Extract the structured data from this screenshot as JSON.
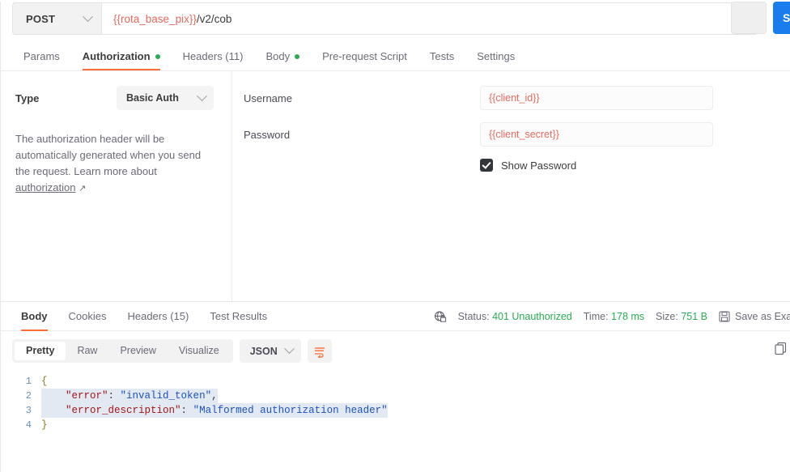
{
  "request": {
    "method": "POST",
    "url_variable": "{{rota_base_pix}}",
    "url_path": "/v2/cob",
    "send_label": "Send",
    "tabs": [
      {
        "label": "Params",
        "active": false,
        "dot": false
      },
      {
        "label": "Authorization",
        "active": true,
        "dot": true
      },
      {
        "label": "Headers (11)",
        "active": false,
        "dot": false
      },
      {
        "label": "Body",
        "active": false,
        "dot": true
      },
      {
        "label": "Pre-request Script",
        "active": false,
        "dot": false
      },
      {
        "label": "Tests",
        "active": false,
        "dot": false
      },
      {
        "label": "Settings",
        "active": false,
        "dot": false
      }
    ]
  },
  "authorization": {
    "type_label": "Type",
    "type_value": "Basic Auth",
    "help_text_part1": "The authorization header will be automatically generated when you send the request. Learn more about ",
    "help_link": "authorization",
    "help_link_arrow": "↗",
    "username_label": "Username",
    "username_value": "{{client_id}}",
    "password_label": "Password",
    "password_value": "{{client_secret}}",
    "show_password_label": "Show Password",
    "show_password_checked": true
  },
  "response": {
    "tabs": [
      {
        "label": "Body",
        "active": true
      },
      {
        "label": "Cookies",
        "active": false
      },
      {
        "label": "Headers (15)",
        "active": false
      },
      {
        "label": "Test Results",
        "active": false
      }
    ],
    "status_label": "Status:",
    "status_value": "401 Unauthorized",
    "time_label": "Time:",
    "time_value": "178 ms",
    "size_label": "Size:",
    "size_value": "751 B",
    "save_example_label": "Save as Exa",
    "format_pills": [
      {
        "label": "Pretty",
        "active": true
      },
      {
        "label": "Raw",
        "active": false
      },
      {
        "label": "Preview",
        "active": false
      },
      {
        "label": "Visualize",
        "active": false
      }
    ],
    "language": "JSON",
    "body_lines": [
      {
        "num": "1",
        "selected": false,
        "segments": [
          {
            "t": "{",
            "c": "brace"
          }
        ]
      },
      {
        "num": "2",
        "selected": true,
        "segments": [
          {
            "t": "    ",
            "c": "punc"
          },
          {
            "t": "\"error\"",
            "c": "key"
          },
          {
            "t": ": ",
            "c": "punc"
          },
          {
            "t": "\"invalid_token\"",
            "c": "str"
          },
          {
            "t": ",",
            "c": "punc"
          }
        ]
      },
      {
        "num": "3",
        "selected": true,
        "segments": [
          {
            "t": "    ",
            "c": "punc"
          },
          {
            "t": "\"error_description\"",
            "c": "key"
          },
          {
            "t": ": ",
            "c": "punc"
          },
          {
            "t": "\"Malformed authorization header\"",
            "c": "str"
          }
        ]
      },
      {
        "num": "4",
        "selected": false,
        "segments": [
          {
            "t": "}",
            "c": "brace"
          }
        ]
      }
    ]
  },
  "colors": {
    "accent_orange": "#ff6c37",
    "send_blue": "#1a7ced",
    "status_green": "#28ac54",
    "variable_red": "#ea6a5e"
  }
}
